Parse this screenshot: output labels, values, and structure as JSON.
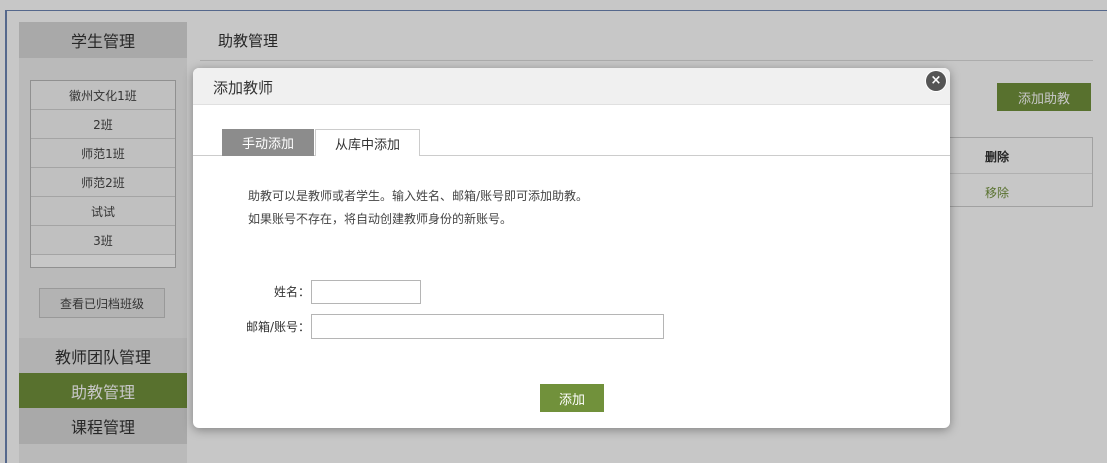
{
  "sidebar": {
    "student_management": "学生管理",
    "classes": [
      "徽州文化1班",
      "2班",
      "师范1班",
      "师范2班",
      "试试",
      "3班"
    ],
    "archive_button": "查看已归档班级",
    "teacher_team": "教师团队管理",
    "assistant_management": "助教管理",
    "course_management": "课程管理"
  },
  "main": {
    "title": "助教管理",
    "add_assistant_button": "添加助教",
    "table_header_delete": "删除",
    "row_action_remove": "移除"
  },
  "modal": {
    "title": "添加教师",
    "close_glyph": "×",
    "tabs": [
      "手动添加",
      "从库中添加"
    ],
    "info_line_1": "助教可以是教师或者学生。输入姓名、邮箱/账号即可添加助教。",
    "info_line_2": "如果账号不存在，将自动创建教师身份的新账号。",
    "name_label": "姓名：",
    "email_label": "邮箱/账号：",
    "name_value": "",
    "email_value": "",
    "submit_button": "添加"
  },
  "colors": {
    "accent_green": "#71913b",
    "active_tab_gray": "#8c8c8c",
    "sidebar_header": "#d9d9d9"
  }
}
